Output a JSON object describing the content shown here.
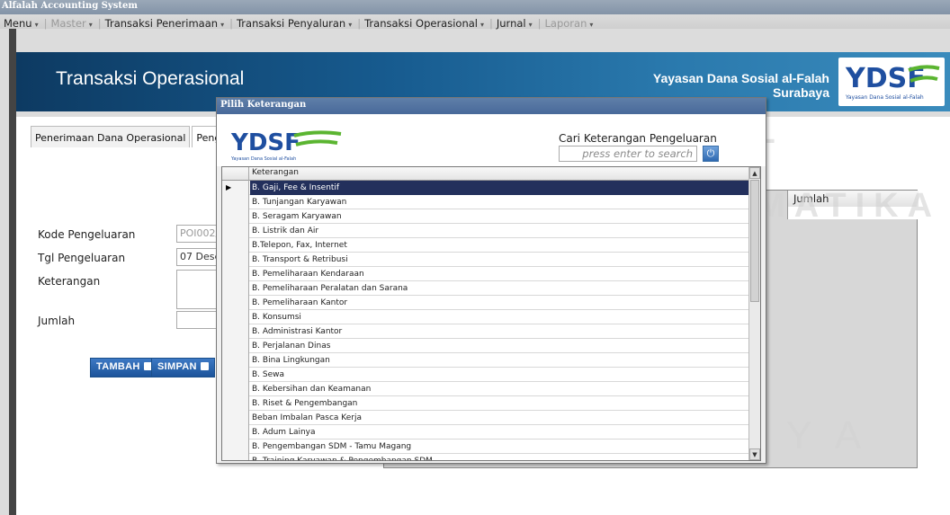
{
  "app": {
    "title": "Alfalah Accounting System"
  },
  "menu": [
    {
      "label": "Menu",
      "disabled": false
    },
    {
      "label": "Master",
      "disabled": true
    },
    {
      "label": "Transaksi Penerimaan",
      "disabled": false
    },
    {
      "label": "Transaksi Penyaluran",
      "disabled": false
    },
    {
      "label": "Transaksi Operasional",
      "disabled": false
    },
    {
      "label": "Jurnal",
      "disabled": false
    },
    {
      "label": "Laporan",
      "disabled": true
    }
  ],
  "banner": {
    "title": "Transaksi Operasional",
    "org_line1": "Yayasan Dana Sosial al-Falah",
    "org_line2": "Surabaya",
    "logo_text": "YDSF",
    "logo_subtext": "Yayasan Dana Sosial al-Falah"
  },
  "tabs": [
    {
      "label": "Penerimaan Dana Operasional",
      "active": false
    },
    {
      "label": "Pengelua",
      "active": true
    }
  ],
  "form": {
    "kode_label": "Kode Pengeluaran",
    "kode_value": "POI002/",
    "tgl_label": "Tgl Pengeluaran",
    "tgl_value": "07 Dese",
    "ket_label": "Keterangan",
    "jumlah_label": "Jumlah",
    "tambah_label": "TAMBAH",
    "simpan_label": "SIMPAN"
  },
  "detail_grid": {
    "jumlah_header": "Jumlah"
  },
  "dialog": {
    "title": "Pilih Keterangan",
    "search_label": "Cari Keterangan Pengeluaran",
    "search_placeholder": "press enter to search",
    "column_header": "Keterangan",
    "selected_index": 0,
    "items": [
      "B. Gaji, Fee & Insentif",
      "B. Tunjangan Karyawan",
      "B. Seragam Karyawan",
      "B. Listrik dan Air",
      "B.Telepon, Fax, Internet",
      "B. Transport & Retribusi",
      "B. Pemeliharaan Kendaraan",
      "B. Pemeliharaan Peralatan dan Sarana",
      "B. Pemeliharaan Kantor",
      "B. Konsumsi",
      "B. Administrasi Kantor",
      "B. Perjalanan Dinas",
      "B. Bina Lingkungan",
      "B. Sewa",
      "B. Kebersihan dan Keamanan",
      "B. Riset & Pengembangan",
      "Beban Imbalan Pasca Kerja",
      "B. Adum Lainya",
      "B. Pengembangan SDM - Tamu Magang",
      "B. Training Karyawan & Pengembangan SDM"
    ]
  },
  "watermark": {
    "line1": "INSTITUT BISNIS",
    "line2": "DAN INFORMATIKA",
    "line3": "SURABAYA"
  },
  "colors": {
    "banner_dark": "#0d3a62",
    "banner_light": "#3a8bbc",
    "button_blue": "#1c549b",
    "selected_row": "#23305c",
    "logo_blue": "#1f4fa0",
    "logo_green": "#5bb531"
  }
}
